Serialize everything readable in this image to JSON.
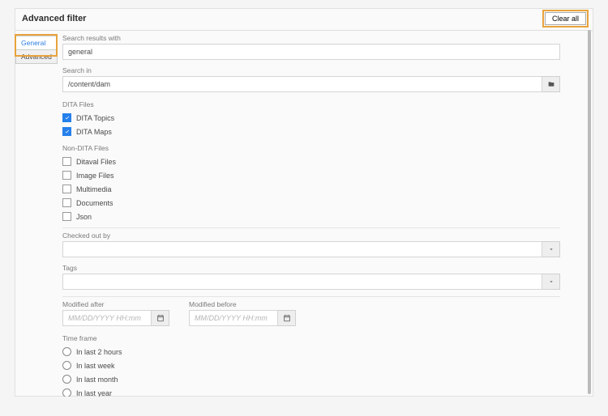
{
  "header": {
    "title": "Advanced filter",
    "clear_all": "Clear all"
  },
  "sidebar": {
    "tab_general": "General",
    "tab_advanced": "Advanced"
  },
  "search_results": {
    "label": "Search results with",
    "value": "general"
  },
  "search_in": {
    "label": "Search in",
    "value": "/content/dam"
  },
  "dita": {
    "section": "DITA Files",
    "topics": "DITA Topics",
    "maps": "DITA Maps"
  },
  "nondita": {
    "section": "Non-DITA Files",
    "items": [
      "Ditaval Files",
      "Image Files",
      "Multimedia",
      "Documents",
      "Json"
    ]
  },
  "checked_out": {
    "label": "Checked out by"
  },
  "tags": {
    "label": "Tags"
  },
  "mod_after": {
    "label": "Modified after",
    "placeholder": "MM/DD/YYYY HH:mm"
  },
  "mod_before": {
    "label": "Modified before",
    "placeholder": "MM/DD/YYYY HH:mm"
  },
  "timeframe": {
    "section": "Time frame",
    "items": [
      "In last 2 hours",
      "In last week",
      "In last month",
      "In last year"
    ]
  }
}
